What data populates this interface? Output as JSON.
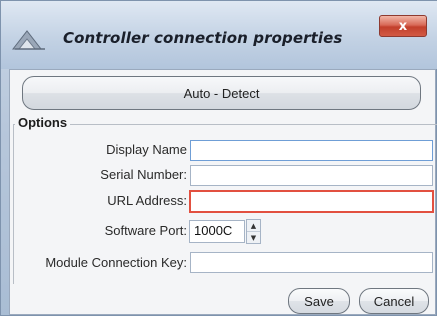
{
  "window": {
    "title": "Controller connection properties",
    "close_glyph": "x"
  },
  "auto_detect_label": "Auto - Detect",
  "options": {
    "group_label": "Options",
    "display_name": {
      "label": "Display Name",
      "value": ""
    },
    "serial_number": {
      "label": "Serial Number:",
      "value": ""
    },
    "url_address": {
      "label": "URL Address:",
      "value": ""
    },
    "software_port": {
      "label": "Software Port:",
      "value": "1000C"
    },
    "module_key": {
      "label": "Module Connection Key:",
      "value": ""
    }
  },
  "buttons": {
    "save": "Save",
    "cancel": "Cancel"
  },
  "icons": {
    "app": "controller-app-icon",
    "spin_up": "triangle-up-icon",
    "spin_down": "triangle-down-icon"
  },
  "colors": {
    "error_border": "#e25040",
    "focus_border": "#6f9ed6",
    "close_button": "#c2402c"
  }
}
